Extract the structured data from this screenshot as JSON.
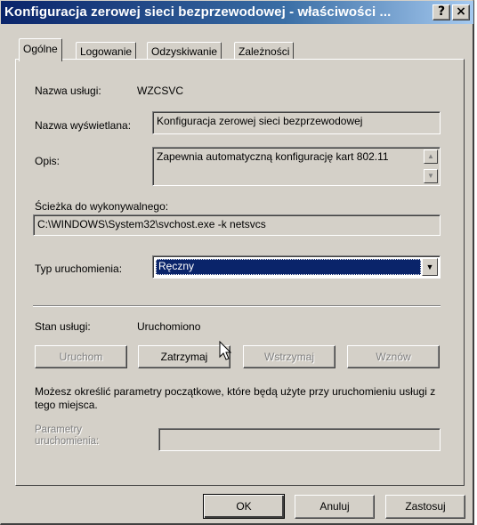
{
  "window": {
    "title": "Konfiguracja zerowej sieci bezprzewodowej - właściwości ...",
    "help_label": "?",
    "close_label": "×"
  },
  "tabs": [
    {
      "label": "Ogólne",
      "active": true
    },
    {
      "label": "Logowanie",
      "active": false
    },
    {
      "label": "Odzyskiwanie",
      "active": false
    },
    {
      "label": "Zależności",
      "active": false
    }
  ],
  "general": {
    "service_name_label": "Nazwa usługi:",
    "service_name_value": "WZCSVC",
    "display_name_label": "Nazwa wyświetlana:",
    "display_name_value": "Konfiguracja zerowej sieci bezprzewodowej",
    "description_label": "Opis:",
    "description_value": "Zapewnia automatyczną konfigurację kart 802.11",
    "exe_path_label": "Ścieżka do wykonywalnego:",
    "exe_path_value": "C:\\WINDOWS\\System32\\svchost.exe -k netsvcs",
    "startup_type_label": "Typ uruchomienia:",
    "startup_type_value": "Ręczny",
    "service_status_label": "Stan usługi:",
    "service_status_value": "Uruchomiono",
    "start_button": "Uruchom",
    "stop_button": "Zatrzymaj",
    "pause_button": "Wstrzymaj",
    "resume_button": "Wznów",
    "info_text": "Możesz określić parametry początkowe, które będą użyte przy uruchomieniu usługi z tego miejsca.",
    "start_params_label": "Parametry uruchomienia:",
    "start_params_value": ""
  },
  "footer": {
    "ok_button": "OK",
    "cancel_button": "Anuluj",
    "apply_button": "Zastosuj"
  },
  "icons": {
    "scroll_up": "scroll-up-arrow-icon",
    "scroll_down": "scroll-down-arrow-icon",
    "dropdown": "chevron-down-icon",
    "cursor": "mouse-pointer-icon"
  }
}
